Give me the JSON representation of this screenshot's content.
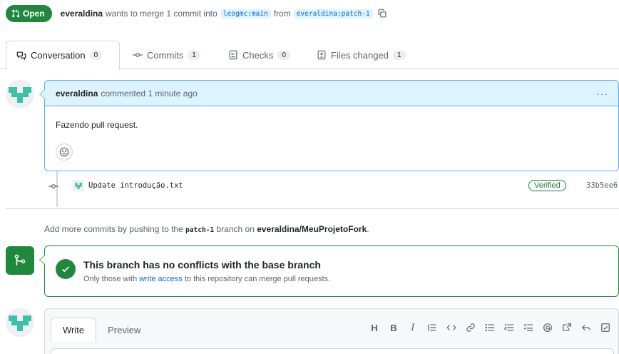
{
  "header": {
    "state_label": "Open",
    "author": "everaldina",
    "merge_text": "wants to merge 1 commit into",
    "base_branch": "leogmc:main",
    "from_text": "from",
    "head_branch": "everaldina:patch-1"
  },
  "tabs": [
    {
      "label": "Conversation",
      "count": "0"
    },
    {
      "label": "Commits",
      "count": "1"
    },
    {
      "label": "Checks",
      "count": "0"
    },
    {
      "label": "Files changed",
      "count": "1"
    }
  ],
  "comment": {
    "author": "everaldina",
    "meta": "commented 1 minute ago",
    "menu": "···",
    "body": "Fazendo pull request."
  },
  "commit": {
    "message": "Update introdução.txt",
    "verified_label": "Verified",
    "sha": "33b5ee6"
  },
  "hint": {
    "prefix": "Add more commits by pushing to the",
    "branch": "patch-1",
    "middle": "branch on",
    "repo": "everaldina/MeuProjetoFork",
    "suffix": "."
  },
  "merge": {
    "title": "This branch has no conflicts with the base branch",
    "sub_prefix": "Only those with",
    "sub_link": "write access",
    "sub_suffix": "to this repository can merge pull requests."
  },
  "editor": {
    "write_tab": "Write",
    "preview_tab": "Preview",
    "toolbar": [
      "H",
      "B",
      "I"
    ]
  },
  "colors": {
    "success": "#1f883d",
    "accent": "#0969da",
    "comment_header": "#ddf4ff"
  }
}
